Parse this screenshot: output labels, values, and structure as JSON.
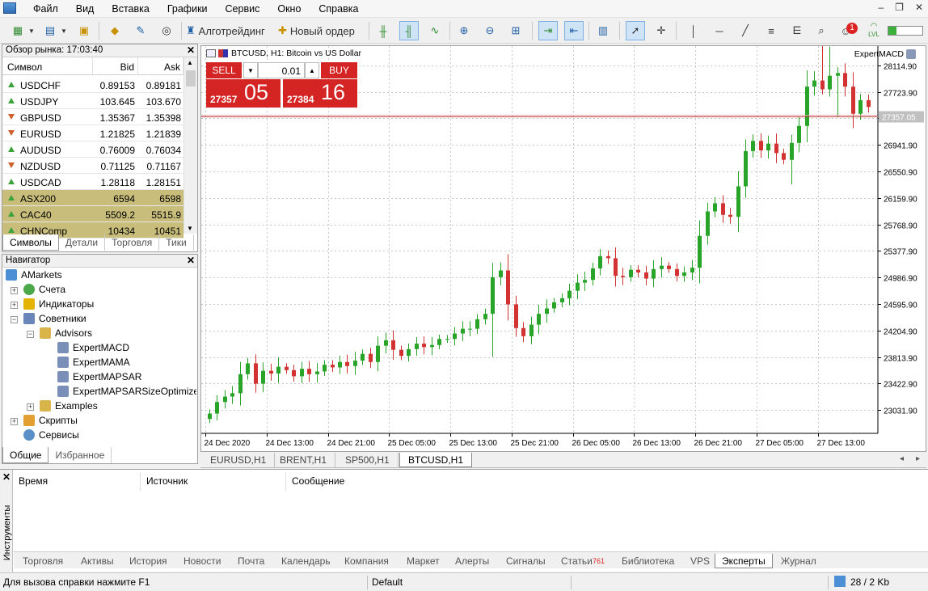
{
  "menu": {
    "items": [
      "Файл",
      "Вид",
      "Вставка",
      "Графики",
      "Сервис",
      "Окно",
      "Справка"
    ]
  },
  "toolbar": {
    "algotrading_label": "Алготрейдинг",
    "new_order_label": "Новый ордер",
    "notification_count": "1",
    "lvl_label": "LVL"
  },
  "market_watch": {
    "title": "Обзор рынка: 17:03:40",
    "columns": [
      "Символ",
      "Bid",
      "Ask"
    ],
    "rows": [
      {
        "symbol": "USDCHF",
        "bid": "0.89153",
        "ask": "0.89181",
        "dir": "up",
        "hl": false
      },
      {
        "symbol": "USDJPY",
        "bid": "103.645",
        "ask": "103.670",
        "dir": "up",
        "hl": false
      },
      {
        "symbol": "GBPUSD",
        "bid": "1.35367",
        "ask": "1.35398",
        "dir": "dn",
        "hl": false
      },
      {
        "symbol": "EURUSD",
        "bid": "1.21825",
        "ask": "1.21839",
        "dir": "dn",
        "hl": false
      },
      {
        "symbol": "AUDUSD",
        "bid": "0.76009",
        "ask": "0.76034",
        "dir": "up",
        "hl": false
      },
      {
        "symbol": "NZDUSD",
        "bid": "0.71125",
        "ask": "0.71167",
        "dir": "dn",
        "hl": false
      },
      {
        "symbol": "USDCAD",
        "bid": "1.28118",
        "ask": "1.28151",
        "dir": "up",
        "hl": false
      },
      {
        "symbol": "ASX200",
        "bid": "6594",
        "ask": "6598",
        "dir": "up",
        "hl": true
      },
      {
        "symbol": "CAC40",
        "bid": "5509.2",
        "ask": "5515.9",
        "dir": "up",
        "hl": true
      },
      {
        "symbol": "CHNComp",
        "bid": "10434",
        "ask": "10451",
        "dir": "up",
        "hl": true
      }
    ],
    "tabs": [
      "Символы",
      "Детали",
      "Торговля",
      "Тики"
    ]
  },
  "navigator": {
    "title": "Навигатор",
    "root": "AMarkets",
    "accounts": "Счета",
    "indicators": "Индикаторы",
    "advisors_group": "Советники",
    "advisors_folder": "Advisors",
    "experts": [
      "ExpertMACD",
      "ExpertMAMA",
      "ExpertMAPSAR",
      "ExpertMAPSARSizeOptimized"
    ],
    "examples": "Examples",
    "scripts": "Скрипты",
    "services": "Сервисы",
    "tabs": [
      "Общие",
      "Избранное"
    ]
  },
  "chart": {
    "symbol_title": "BTCUSD, H1:  Bitcoin vs US Dollar",
    "expert_label": "ExpertMACD",
    "sell_label": "SELL",
    "buy_label": "BUY",
    "volume": "0.01",
    "sell_price_prefix": "27357",
    "sell_price_big": "05",
    "buy_price_prefix": "27384",
    "buy_price_big": "16",
    "current_price_label": "27357.05",
    "tabs": [
      "EURUSD,H1",
      "BRENT,H1",
      "SP500,H1",
      "BTCUSD,H1"
    ],
    "active_tab": "BTCUSD,H1"
  },
  "chart_data": {
    "type": "candlestick",
    "symbol": "BTCUSD",
    "timeframe": "H1",
    "ylim": [
      22700,
      28350
    ],
    "y_ticks": [
      "28114.90",
      "27723.90",
      "27332.90",
      "26941.90",
      "26550.90",
      "26159.90",
      "25768.90",
      "25377.90",
      "24986.90",
      "24595.90",
      "24204.90",
      "23813.90",
      "23422.90",
      "23031.90"
    ],
    "x_ticks": [
      "24 Dec 2020",
      "24 Dec 13:00",
      "24 Dec 21:00",
      "25 Dec 05:00",
      "25 Dec 13:00",
      "25 Dec 21:00",
      "26 Dec 05:00",
      "26 Dec 13:00",
      "26 Dec 21:00",
      "27 Dec 05:00",
      "27 Dec 13:00"
    ],
    "current_price": 27357.05,
    "closes": [
      22980,
      23150,
      23230,
      23280,
      23560,
      23720,
      23420,
      23610,
      23570,
      23670,
      23620,
      23530,
      23640,
      23560,
      23600,
      23700,
      23660,
      23740,
      23680,
      23760,
      23860,
      23740,
      23980,
      24060,
      23920,
      23830,
      23930,
      24010,
      23960,
      23990,
      24080,
      24080,
      24160,
      24230,
      24230,
      24370,
      24450,
      24990,
      25090,
      24590,
      24240,
      24120,
      24290,
      24450,
      24530,
      24620,
      24680,
      24790,
      24910,
      24950,
      25120,
      25300,
      25270,
      25010,
      24990,
      25100,
      25060,
      24970,
      25110,
      25160,
      25110,
      25010,
      25060,
      25130,
      25600,
      25960,
      26080,
      25910,
      25880,
      26330,
      26850,
      27000,
      26860,
      26960,
      26820,
      26720,
      26970,
      27220,
      27800,
      27890,
      27760,
      27960,
      28000,
      27800,
      27400,
      27600,
      27500
    ],
    "opens": [
      22900,
      22980,
      23150,
      23230,
      23280,
      23560,
      23720,
      23420,
      23610,
      23570,
      23670,
      23620,
      23530,
      23640,
      23560,
      23600,
      23700,
      23660,
      23740,
      23680,
      23760,
      23860,
      23740,
      23980,
      24060,
      23920,
      23830,
      23930,
      24010,
      23960,
      23990,
      24080,
      24080,
      24160,
      24230,
      24230,
      24370,
      24450,
      24990,
      25090,
      24590,
      24240,
      24120,
      24290,
      24450,
      24530,
      24620,
      24680,
      24790,
      24910,
      24950,
      25120,
      25300,
      25270,
      25010,
      24990,
      25100,
      25060,
      24970,
      25110,
      25160,
      25110,
      25010,
      25060,
      25130,
      25600,
      25960,
      26080,
      25910,
      25880,
      26330,
      26850,
      27000,
      26860,
      26960,
      26820,
      26720,
      26970,
      27220,
      27800,
      27890,
      27760,
      27960,
      28000,
      27800,
      27400,
      27600
    ]
  },
  "toolbox": {
    "side_label": "Инструменты",
    "columns": [
      "Время",
      "Источник",
      "Сообщение"
    ],
    "tabs": [
      "Торговля",
      "Активы",
      "История",
      "Новости",
      "Почта",
      "Календарь",
      "Компания",
      "Маркет",
      "Алерты",
      "Сигналы",
      "Статьи",
      "Библиотека",
      "VPS",
      "Эксперты",
      "Журнал"
    ],
    "articles_badge": "761",
    "active_tab": "Эксперты"
  },
  "status": {
    "help": "Для вызова справки нажмите F1",
    "profile": "Default",
    "traffic": "28 / 2 Kb"
  }
}
